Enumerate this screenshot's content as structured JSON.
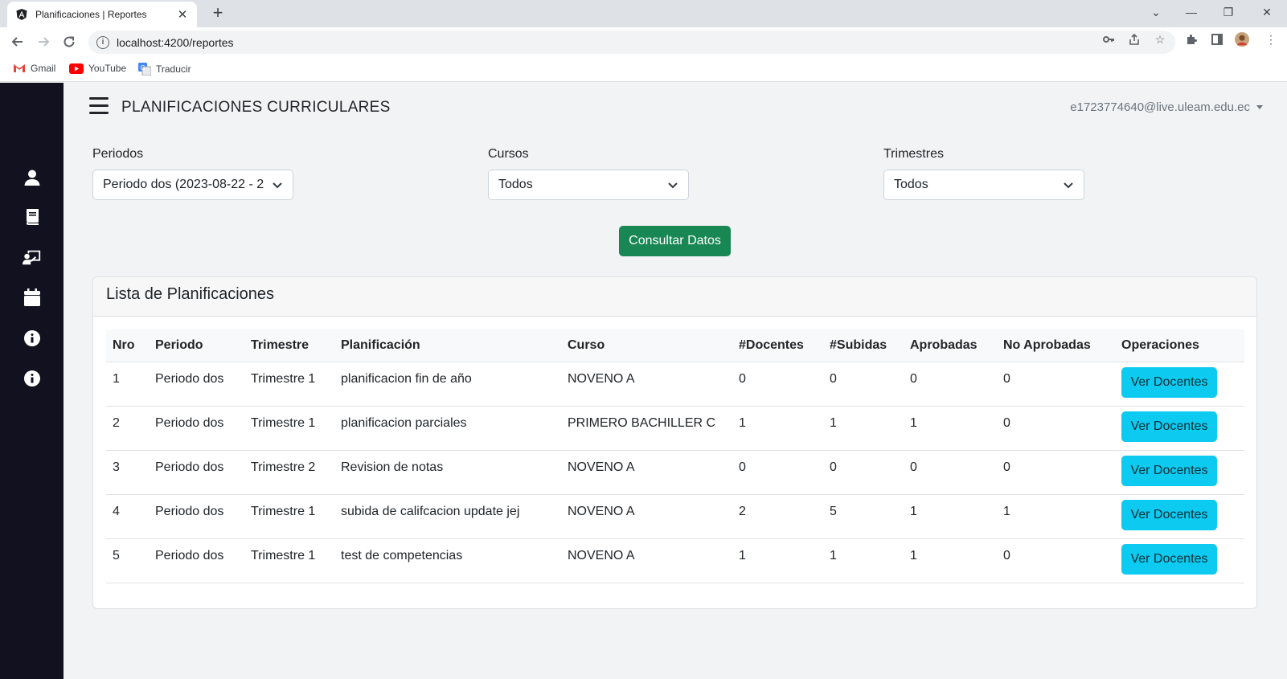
{
  "browser": {
    "tab_title": "Planificaciones | Reportes",
    "url": "localhost:4200/reportes",
    "bookmarks": [
      {
        "label": "Gmail",
        "icon": "gmail-icon"
      },
      {
        "label": "YouTube",
        "icon": "youtube-icon"
      },
      {
        "label": "Traducir",
        "icon": "translate-icon"
      }
    ]
  },
  "app": {
    "title": "PLANIFICACIONES CURRICULARES",
    "user_email": "e1723774640@live.uleam.edu.ec",
    "sidebar_icons": [
      "user-icon",
      "book-icon",
      "teacher-icon",
      "calendar-icon",
      "info-icon",
      "info-icon"
    ]
  },
  "filters": {
    "periodos": {
      "label": "Periodos",
      "value": "Periodo dos (2023-08-22 - 2"
    },
    "cursos": {
      "label": "Cursos",
      "value": "Todos"
    },
    "trimestres": {
      "label": "Trimestres",
      "value": "Todos"
    },
    "submit_label": "Consultar Datos"
  },
  "card": {
    "title": "Lista de Planificaciones",
    "columns": [
      "Nro",
      "Periodo",
      "Trimestre",
      "Planificación",
      "Curso",
      "#Docentes",
      "#Subidas",
      "Aprobadas",
      "No Aprobadas",
      "Operaciones"
    ],
    "rows": [
      [
        "1",
        "Periodo dos",
        "Trimestre 1",
        "planificacion fin de año",
        "NOVENO A",
        "0",
        "0",
        "0",
        "0"
      ],
      [
        "2",
        "Periodo dos",
        "Trimestre 1",
        "planificacion parciales",
        "PRIMERO BACHILLER C",
        "1",
        "1",
        "1",
        "0"
      ],
      [
        "3",
        "Periodo dos",
        "Trimestre 2",
        "Revision de notas",
        "NOVENO A",
        "0",
        "0",
        "0",
        "0"
      ],
      [
        "4",
        "Periodo dos",
        "Trimestre 1",
        "subida de califcacion update jej",
        "NOVENO A",
        "2",
        "5",
        "1",
        "1"
      ],
      [
        "5",
        "Periodo dos",
        "Trimestre 1",
        "test de competencias",
        "NOVENO A",
        "1",
        "1",
        "1",
        "0"
      ]
    ],
    "action_label": "Ver Docentes"
  },
  "colors": {
    "sidebar": "#11111f",
    "success": "#198754",
    "info": "#0dcaf0"
  }
}
